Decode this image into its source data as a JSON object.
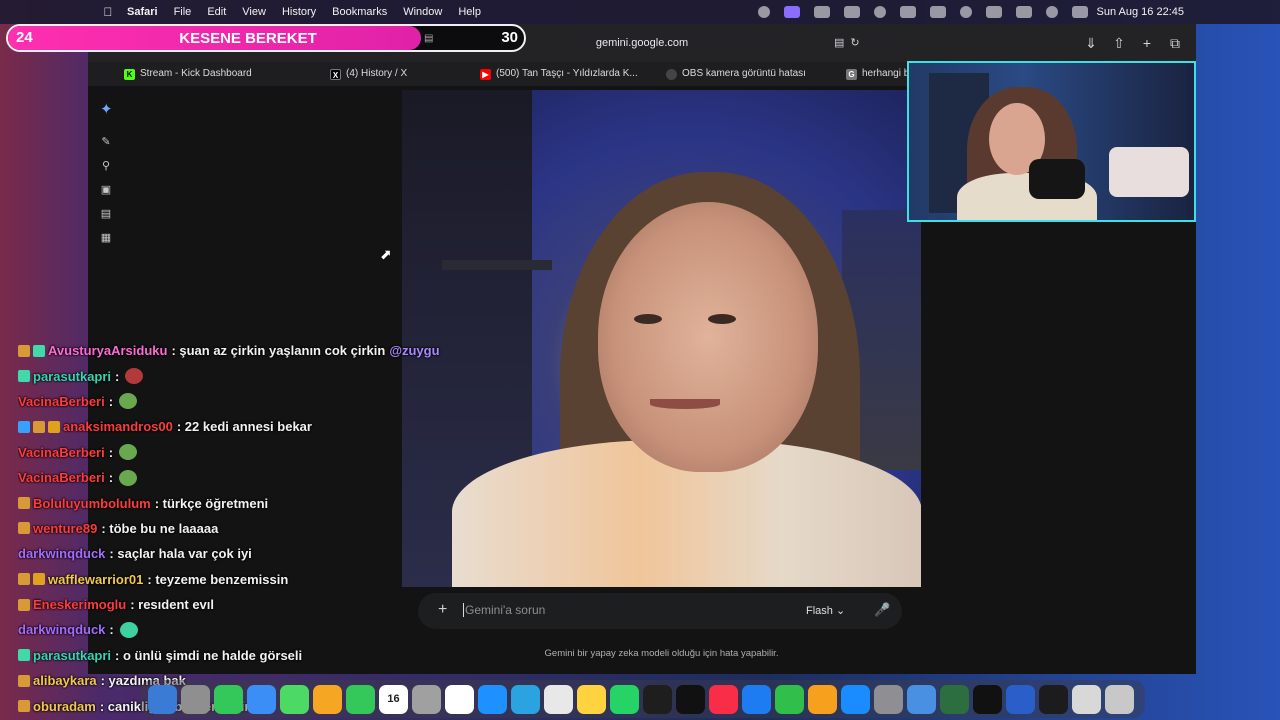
{
  "menubar": {
    "app": "Safari",
    "menus": [
      "Safari",
      "File",
      "Edit",
      "View",
      "History",
      "Bookmarks",
      "Window",
      "Help"
    ],
    "clock": "Sun Aug 16  22:45"
  },
  "browser": {
    "url": "gemini.google.com",
    "tabs": [
      {
        "label": "Stream - Kick Dashboard",
        "icon": "kick-icon",
        "color": "#53fc18"
      },
      {
        "label": "(4) History / X",
        "icon": "x-icon",
        "color": "#000000"
      },
      {
        "label": "(500) Tan Taşçı - Yıldızlarda K...",
        "icon": "youtube-icon",
        "color": "#ff0000"
      },
      {
        "label": "OBS kamera görüntü hatası",
        "icon": "obs-icon",
        "color": "#444444"
      },
      {
        "label": "herhangi bi",
        "icon": "google-icon",
        "color": "#777777"
      }
    ]
  },
  "gemini": {
    "input_placeholder": "Gemini'a sorun",
    "model": "Flash",
    "disclaimer": "Gemini bir yapay zeka modeli olduğu için hata yapabilir."
  },
  "banner": {
    "left_count": "24",
    "title": "KESENE BEREKET",
    "right_count": "30",
    "progress": 0.8
  },
  "chat": [
    {
      "user": "AvusturyaArsiduku",
      "color": "#ff6bd6",
      "message": ": şuan az çirkin yaşlanın cok çirkin",
      "mention": "@zuygu",
      "badges": [
        "#d89a36",
        "#40d9a8"
      ]
    },
    {
      "user": "parasutkapri",
      "color": "#33d6b0",
      "message": ":",
      "emote": "#b33a3a",
      "badges": [
        "#40d9a8"
      ]
    },
    {
      "user": "VacinaBerberi",
      "color": "#ff3b3b",
      "message": ":",
      "emote": "#6aa84f",
      "badges": []
    },
    {
      "user": "anaksimandros00",
      "color": "#ff3b3b",
      "message": ": 22 kedi annesi bekar",
      "badges": [
        "#3aa0ff",
        "#d89a36",
        "#e0a020"
      ]
    },
    {
      "user": "VacinaBerberi",
      "color": "#ff3b3b",
      "message": ":",
      "emote": "#6aa84f",
      "badges": []
    },
    {
      "user": "VacinaBerberi",
      "color": "#ff3b3b",
      "message": ":",
      "emote": "#6aa84f",
      "badges": []
    },
    {
      "user": "Boluluyumbolulum",
      "color": "#ff3b3b",
      "message": ": türkçe öğretmeni",
      "badges": [
        "#d89a36"
      ]
    },
    {
      "user": "wenture89",
      "color": "#ff3b3b",
      "message": ": töbe bu ne laaaaa",
      "badges": [
        "#d89a36"
      ]
    },
    {
      "user": "darkwinqduck",
      "color": "#a66cff",
      "message": ": saçlar hala var çok iyi",
      "badges": []
    },
    {
      "user": "wafflewarrior01",
      "color": "#f2c94c",
      "message": ": teyzeme benzemissin",
      "badges": [
        "#d89a36",
        "#e0a020"
      ]
    },
    {
      "user": "Eneskerimoglu",
      "color": "#ff3b3b",
      "message": ": resıdent evıl",
      "badges": [
        "#d89a36"
      ]
    },
    {
      "user": "darkwinqduck",
      "color": "#a66cff",
      "message": ":",
      "emote": "#3fd0a0",
      "badges": []
    },
    {
      "user": "parasutkapri",
      "color": "#33d6b0",
      "message": ": o ünlü şimdi ne halde görseli",
      "badges": [
        "#40d9a8"
      ]
    },
    {
      "user": "alibaykara",
      "color": "#f2c94c",
      "message": ": yazdıma bak",
      "badges": [
        "#d89a36"
      ]
    },
    {
      "user": "oburadam",
      "color": "#f2c94c",
      "message": ": canikligile benzemişsin",
      "badges": [
        "#d89a36"
      ]
    }
  ],
  "dock": {
    "apps": [
      "finder",
      "launchpad",
      "messages",
      "mail",
      "maps",
      "photos",
      "facetime",
      "calendar",
      "contacts",
      "reminders",
      "safari",
      "telegram",
      "chrome",
      "notes",
      "whatsapp",
      "freeform",
      "tv",
      "music",
      "keynote",
      "numbers",
      "pages",
      "app-store",
      "settings",
      "preview",
      "world",
      "epic",
      "wd",
      "clock",
      "downloads",
      "trash"
    ],
    "calendar_day": "16"
  }
}
